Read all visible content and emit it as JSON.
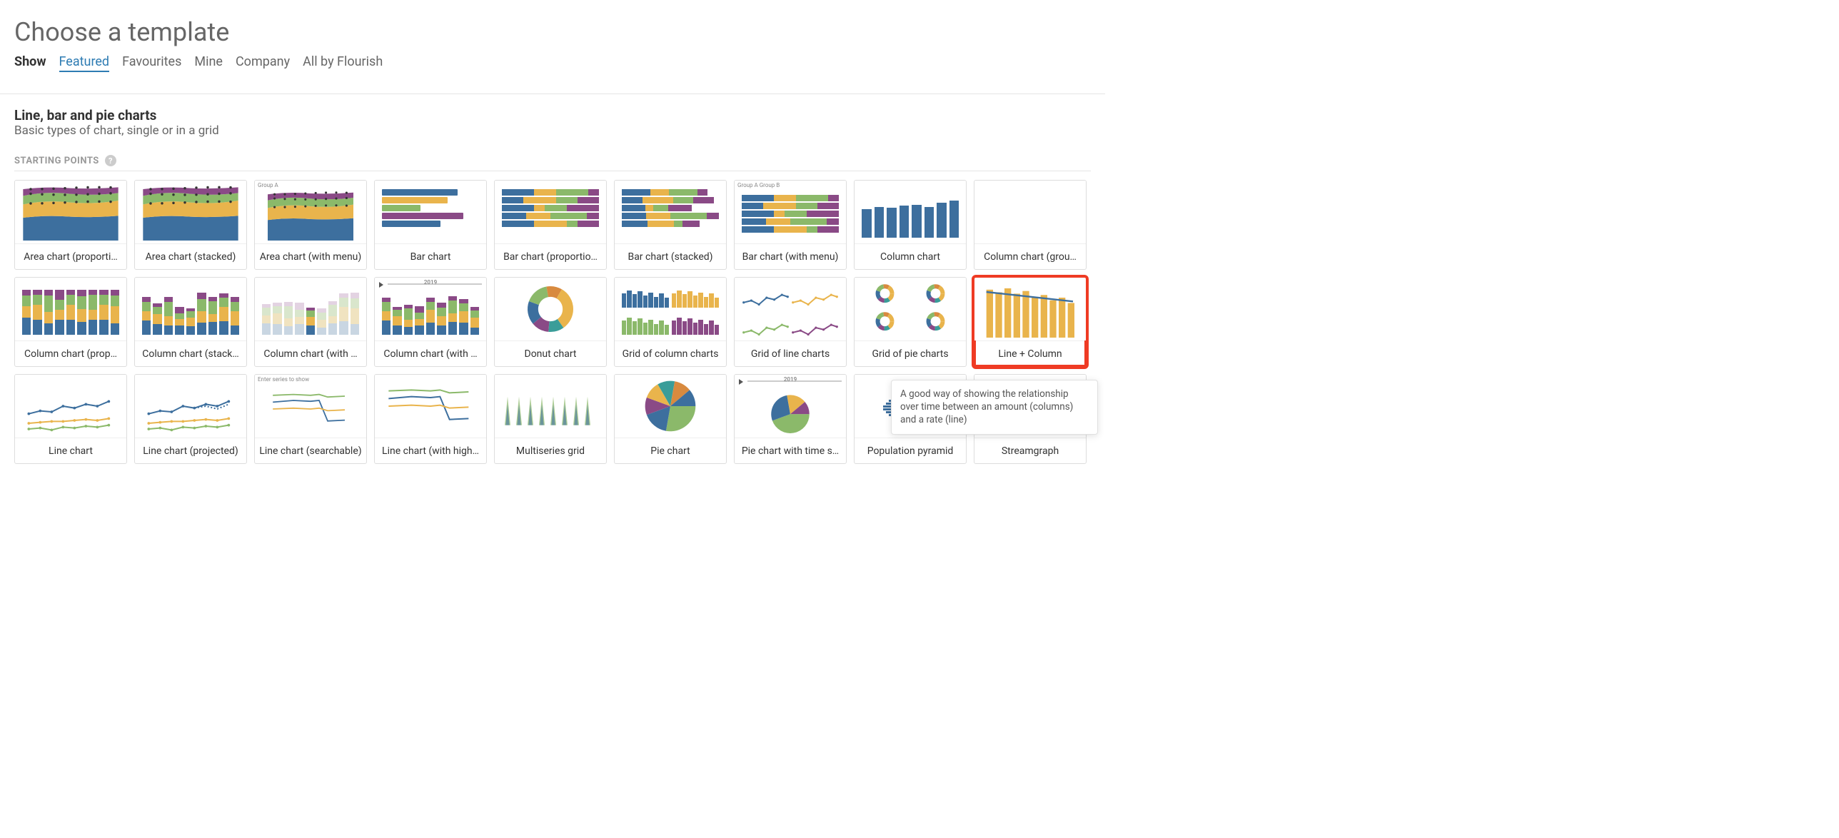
{
  "title": "Choose a template",
  "filters": {
    "label": "Show",
    "tabs": [
      "Featured",
      "Favourites",
      "Mine",
      "Company",
      "All by Flourish"
    ],
    "active": "Featured"
  },
  "section": {
    "title": "Line, bar and pie charts",
    "subtitle": "Basic types of chart, single or in a grid",
    "starting_points_label": "STARTING POINTS",
    "help_glyph": "?"
  },
  "palette": {
    "blue": "#3d6f9e",
    "yellow": "#e9b44c",
    "green": "#8bb96a",
    "purple": "#8a4a86",
    "teal": "#3a9d99",
    "orange": "#d88a3f"
  },
  "templates": [
    {
      "id": "area-proportional",
      "label": "Area chart (proporti…"
    },
    {
      "id": "area-stacked",
      "label": "Area chart (stacked)"
    },
    {
      "id": "area-menu",
      "label": "Area chart (with menu)",
      "mini_text": "Group A"
    },
    {
      "id": "bar",
      "label": "Bar chart"
    },
    {
      "id": "bar-proportional",
      "label": "Bar chart (proportio…"
    },
    {
      "id": "bar-stacked",
      "label": "Bar chart (stacked)"
    },
    {
      "id": "bar-menu",
      "label": "Bar chart (with menu)",
      "mini_text": "Group A   Group B"
    },
    {
      "id": "column",
      "label": "Column chart"
    },
    {
      "id": "column-grouped",
      "label": "Column chart (grou…"
    },
    {
      "id": "column-proportional",
      "label": "Column chart (prop…"
    },
    {
      "id": "column-stacked",
      "label": "Column chart (stack…"
    },
    {
      "id": "column-with-1",
      "label": "Column chart (with …"
    },
    {
      "id": "column-with-2",
      "label": "Column chart (with …",
      "mini_text": "2019"
    },
    {
      "id": "donut",
      "label": "Donut chart"
    },
    {
      "id": "grid-column",
      "label": "Grid of column charts"
    },
    {
      "id": "grid-line",
      "label": "Grid of line charts"
    },
    {
      "id": "grid-pie",
      "label": "Grid of pie charts"
    },
    {
      "id": "line-column",
      "label": "Line + Column",
      "highlight": true
    },
    {
      "id": "line",
      "label": "Line chart"
    },
    {
      "id": "line-projected",
      "label": "Line chart (projected)"
    },
    {
      "id": "line-searchable",
      "label": "Line chart (searchable)",
      "mini_text": "Enter series to show"
    },
    {
      "id": "line-highlight",
      "label": "Line chart (with high…"
    },
    {
      "id": "multiseries-grid",
      "label": "Multiseries grid"
    },
    {
      "id": "pie",
      "label": "Pie chart"
    },
    {
      "id": "pie-time",
      "label": "Pie chart with time s…",
      "mini_text": "2019"
    },
    {
      "id": "population-pyramid",
      "label": "Population pyramid"
    },
    {
      "id": "streamgraph",
      "label": "Streamgraph"
    }
  ],
  "tooltip": {
    "text": "A good way of showing the relationship over time between an amount (columns) and a rate (line)"
  }
}
